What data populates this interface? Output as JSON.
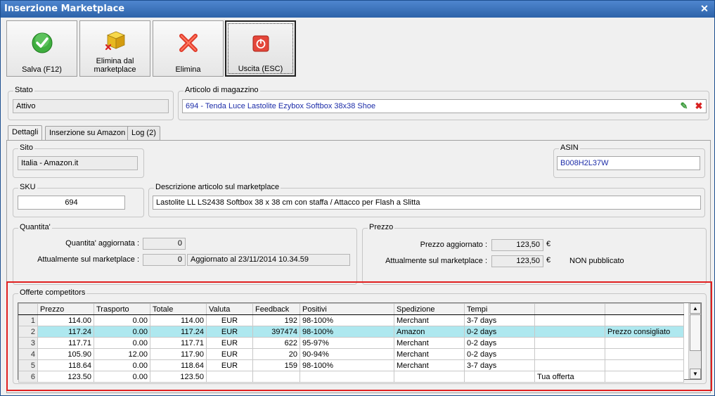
{
  "window": {
    "title": "Inserzione Marketplace"
  },
  "toolbar": {
    "save_label": "Salva (F12)",
    "remove_marketplace_label_1": "Elimina dal",
    "remove_marketplace_label_2": "marketplace",
    "delete_label": "Elimina",
    "exit_label": "Uscita (ESC)"
  },
  "stato": {
    "label": "Stato",
    "value": "Attivo"
  },
  "articolo": {
    "label": "Articolo di magazzino",
    "value": "694 - Tenda Luce Lastolite Ezybox Softbox 38x38 Shoe"
  },
  "tabs": [
    {
      "label": "Dettagli"
    },
    {
      "label": "Inserzione su Amazon"
    },
    {
      "label": "Log (2)"
    }
  ],
  "sito": {
    "label": "Sito",
    "value": "Italia - Amazon.it"
  },
  "asin": {
    "label": "ASIN",
    "value": "B008H2L37W"
  },
  "sku": {
    "label": "SKU",
    "value": "694"
  },
  "descrizione": {
    "label": "Descrizione articolo sul marketplace",
    "value": "Lastolite LL LS2438 Softbox 38 x 38 cm con staffa / Attacco per Flash a Slitta"
  },
  "quantita": {
    "label": "Quantita'",
    "updated_label": "Quantita' aggiornata :",
    "updated_value": "0",
    "current_label": "Attualmente sul marketplace :",
    "current_value": "0",
    "updated_note": "Aggiornato al 23/11/2014 10.34.59"
  },
  "prezzo": {
    "label": "Prezzo",
    "updated_label": "Prezzo aggiornato :",
    "updated_value": "123,50",
    "current_label": "Attualmente sul marketplace :",
    "current_value": "123,50",
    "currency": "€",
    "status": "NON pubblicato"
  },
  "offerte": {
    "label": "Offerte competitors",
    "columns": [
      "Prezzo",
      "Trasporto",
      "Totale",
      "Valuta",
      "Feedback",
      "Positivi",
      "Spedizione",
      "Tempi",
      "",
      ""
    ],
    "rows": [
      {
        "n": "1",
        "prezzo": "114.00",
        "trasporto": "0.00",
        "totale": "114.00",
        "valuta": "EUR",
        "feedback": "192",
        "positivi": "98-100%",
        "spedizione": "Merchant",
        "tempi": "3-7 days",
        "extra1": "",
        "extra2": ""
      },
      {
        "n": "2",
        "prezzo": "117.24",
        "trasporto": "0.00",
        "totale": "117.24",
        "valuta": "EUR",
        "feedback": "397474",
        "positivi": "98-100%",
        "spedizione": "Amazon",
        "tempi": "0-2 days",
        "extra1": "",
        "extra2": "Prezzo consigliato"
      },
      {
        "n": "3",
        "prezzo": "117.71",
        "trasporto": "0.00",
        "totale": "117.71",
        "valuta": "EUR",
        "feedback": "622",
        "positivi": "95-97%",
        "spedizione": "Merchant",
        "tempi": "0-2 days",
        "extra1": "",
        "extra2": ""
      },
      {
        "n": "4",
        "prezzo": "105.90",
        "trasporto": "12.00",
        "totale": "117.90",
        "valuta": "EUR",
        "feedback": "20",
        "positivi": "90-94%",
        "spedizione": "Merchant",
        "tempi": "0-2 days",
        "extra1": "",
        "extra2": ""
      },
      {
        "n": "5",
        "prezzo": "118.64",
        "trasporto": "0.00",
        "totale": "118.64",
        "valuta": "EUR",
        "feedback": "159",
        "positivi": "98-100%",
        "spedizione": "Merchant",
        "tempi": "3-7 days",
        "extra1": "",
        "extra2": ""
      },
      {
        "n": "6",
        "prezzo": "123.50",
        "trasporto": "0.00",
        "totale": "123.50",
        "valuta": "",
        "feedback": "",
        "positivi": "",
        "spedizione": "",
        "tempi": "",
        "extra1": "Tua offerta",
        "extra2": ""
      }
    ],
    "selected_row": 2
  },
  "colors": {
    "highlight_border": "#e02020",
    "selected_row": "#aee8ef",
    "link_text": "#1c2ca8"
  }
}
